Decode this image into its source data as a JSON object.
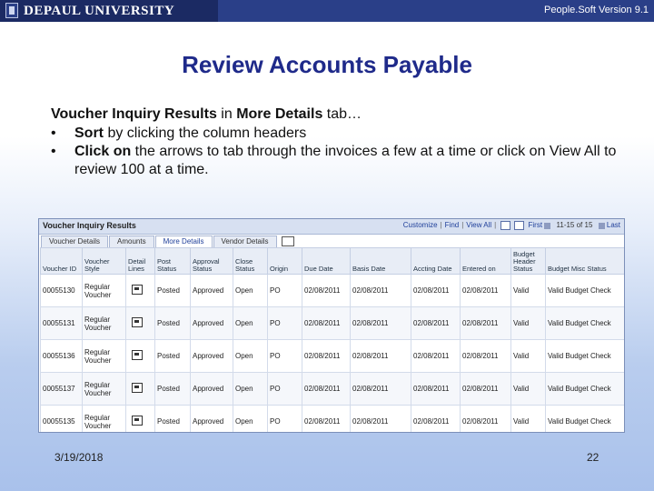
{
  "header": {
    "logo_text": "DEPAUL UNIVERSITY",
    "version": "People.Soft Version 9.1",
    "bar_color": "#2a3f88"
  },
  "slide": {
    "title": "Review Accounts Payable",
    "intro_bold1": "Voucher Inquiry Results",
    "intro_mid": " in ",
    "intro_bold2": "More Details",
    "intro_end": " tab…",
    "bullets": [
      {
        "bold": "Sort",
        "text": " by clicking the column headers"
      },
      {
        "bold": "Click on",
        "text": " the arrows to tab through the invoices a few at a time or click on  View All to review 100 at a time."
      }
    ],
    "bullet_char": "•",
    "date": "3/19/2018",
    "page_number": "22"
  },
  "screenshot": {
    "panel_title": "Voucher Inquiry Results",
    "nav": {
      "customize": "Customize",
      "find": "Find",
      "view_all": "View All",
      "first": "First",
      "count": "11-15 of 15",
      "last": "Last"
    },
    "tabs": [
      "Voucher Details",
      "Amounts",
      "More Details",
      "Vendor Details"
    ],
    "active_tab": "More Details",
    "columns": [
      "Voucher ID",
      "Voucher Style",
      "Detail Lines",
      "Post Status",
      "Approval Status",
      "Close Status",
      "Origin",
      "Due Date",
      "Basis Date",
      "Accting Date",
      "Entered on",
      "Budget Header Status",
      "Budget Misc Status"
    ],
    "rows": [
      [
        "00055130",
        "Regular Voucher",
        "",
        "Posted",
        "Approved",
        "Open",
        "PO",
        "02/08/2011",
        "02/08/2011",
        "02/08/2011",
        "02/08/2011",
        "Valid",
        "Valid Budget Check"
      ],
      [
        "00055131",
        "Regular Voucher",
        "",
        "Posted",
        "Approved",
        "Open",
        "PO",
        "02/08/2011",
        "02/08/2011",
        "02/08/2011",
        "02/08/2011",
        "Valid",
        "Valid Budget Check"
      ],
      [
        "00055136",
        "Regular Voucher",
        "",
        "Posted",
        "Approved",
        "Open",
        "PO",
        "02/08/2011",
        "02/08/2011",
        "02/08/2011",
        "02/08/2011",
        "Valid",
        "Valid Budget Check"
      ],
      [
        "00055137",
        "Regular Voucher",
        "",
        "Posted",
        "Approved",
        "Open",
        "PO",
        "02/08/2011",
        "02/08/2011",
        "02/08/2011",
        "02/08/2011",
        "Valid",
        "Valid Budget Check"
      ],
      [
        "00055135",
        "Regular Voucher",
        "",
        "Posted",
        "Approved",
        "Open",
        "PO",
        "02/08/2011",
        "02/08/2011",
        "02/08/2011",
        "02/08/2011",
        "Valid",
        "Valid Budget Check"
      ]
    ]
  }
}
